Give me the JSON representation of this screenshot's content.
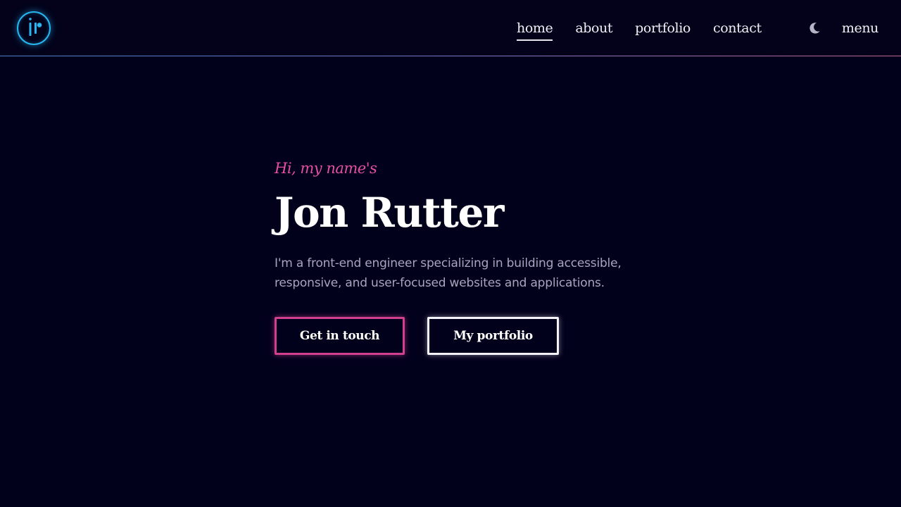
{
  "header": {
    "logo_icon": "jr-monogram-logo-icon",
    "nav": [
      {
        "label": "home",
        "active": true
      },
      {
        "label": "about",
        "active": false
      },
      {
        "label": "portfolio",
        "active": false
      },
      {
        "label": "contact",
        "active": false
      }
    ],
    "theme_toggle_icon": "moon-icon",
    "menu_label": "menu"
  },
  "hero": {
    "greeting": "Hi, my name's",
    "name": "Jon Rutter",
    "intro": "I'm a front-end engineer specializing in building accessible, responsive, and user-focused websites and applications.",
    "primary_button": "Get in touch",
    "secondary_button": "My portfolio"
  },
  "colors": {
    "background": "#02011c",
    "accent_pink": "#e64fa0",
    "logo_cyan": "#27b6f0",
    "text_light": "#f1eef6",
    "text_muted": "#a8a6bd"
  }
}
